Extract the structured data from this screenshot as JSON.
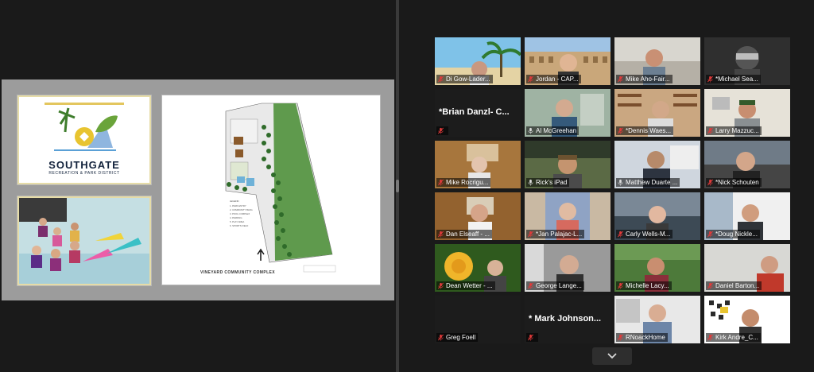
{
  "shared_screen": {
    "logo_title": "SOUTHGATE",
    "logo_subtitle": "RECREATION & PARK DISTRICT",
    "plan_caption": "VINEYARD COMMUNITY COMPLEX"
  },
  "participants": [
    {
      "name": "Di Gow-Lader...",
      "muted": true,
      "bg": "beach"
    },
    {
      "name": "Jordan - CAP...",
      "muted": true,
      "bg": "colosseum"
    },
    {
      "name": "Mike Aho-Fair...",
      "muted": true,
      "bg": "office"
    },
    {
      "name": "*Michael Sea...",
      "muted": true,
      "bg": "helmet"
    },
    {
      "name": "",
      "display_text": "*Brian Danzl- C...",
      "muted": true,
      "bg": "blank"
    },
    {
      "name": "Al McGreehan",
      "muted": false,
      "bg": "room"
    },
    {
      "name": "*Dennis Waes...",
      "muted": true,
      "bg": "books"
    },
    {
      "name": "Larry Mazzuc...",
      "muted": true,
      "bg": "wall"
    },
    {
      "name": "Mike Rocrigu...",
      "muted": true,
      "bg": "kitchen"
    },
    {
      "name": "Rick's iPad",
      "muted": false,
      "bg": "rocks"
    },
    {
      "name": "Matthew Duarte ...",
      "muted": false,
      "bg": "suit",
      "active": true
    },
    {
      "name": "*Nick Schouten",
      "muted": true,
      "bg": "headset"
    },
    {
      "name": "Dan Elseaff - ...",
      "muted": true,
      "bg": "cabinet"
    },
    {
      "name": "*Jan Palajac-L...",
      "muted": true,
      "bg": "portrait"
    },
    {
      "name": "Carly Wells-M...",
      "muted": true,
      "bg": "coast"
    },
    {
      "name": "*Doug Nickle...",
      "muted": true,
      "bg": "window"
    },
    {
      "name": "Dean Wetter - ...",
      "muted": true,
      "bg": "flower"
    },
    {
      "name": "George Lange...",
      "muted": true,
      "bg": "curtain"
    },
    {
      "name": "Michelle Lacy...",
      "muted": true,
      "bg": "garden"
    },
    {
      "name": "Daniel Barton...",
      "muted": true,
      "bg": "plain"
    },
    {
      "name": "Greg Foell",
      "muted": true,
      "bg": "blank"
    },
    {
      "name": "",
      "display_text": "* Mark Johnson...",
      "muted": true,
      "bg": "blank"
    },
    {
      "name": "RNoackHome",
      "muted": true,
      "bg": "shelf"
    },
    {
      "name": "Kirk Andre_C...",
      "muted": true,
      "bg": "poster"
    }
  ],
  "colors": {
    "muted_icon": "#e03a3a",
    "active_border": "#c4d233"
  },
  "icons": {
    "scroll": "chevron-down-icon",
    "mic": "mic-muted-icon"
  }
}
